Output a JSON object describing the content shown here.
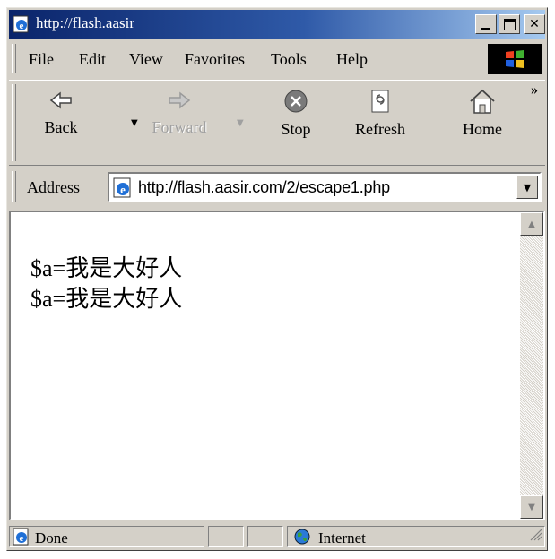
{
  "window": {
    "title": "http://flash.aasir"
  },
  "menu": [
    "File",
    "Edit",
    "View",
    "Favorites",
    "Tools",
    "Help"
  ],
  "toolbar": {
    "back": "Back",
    "forward": "Forward",
    "stop": "Stop",
    "refresh": "Refresh",
    "home": "Home"
  },
  "address": {
    "label": "Address",
    "url": "http://flash.aasir.com/2/escape1.php"
  },
  "content": {
    "lines": [
      "$a=我是大好人",
      "$a=我是大好人"
    ]
  },
  "status": {
    "text": "Done",
    "zone": "Internet"
  },
  "colors": {
    "titlebar_start": "#0a246a",
    "titlebar_end": "#a6caf0",
    "chrome": "#d4d0c8"
  },
  "icons": [
    "ie-page-icon",
    "minimize-icon",
    "maximize-icon",
    "close-icon",
    "windows-logo-icon",
    "back-arrow-icon",
    "forward-arrow-icon",
    "stop-icon",
    "refresh-icon",
    "home-icon",
    "chevron-right-icon",
    "dropdown-arrow-icon",
    "globe-icon",
    "resize-grip-icon"
  ]
}
